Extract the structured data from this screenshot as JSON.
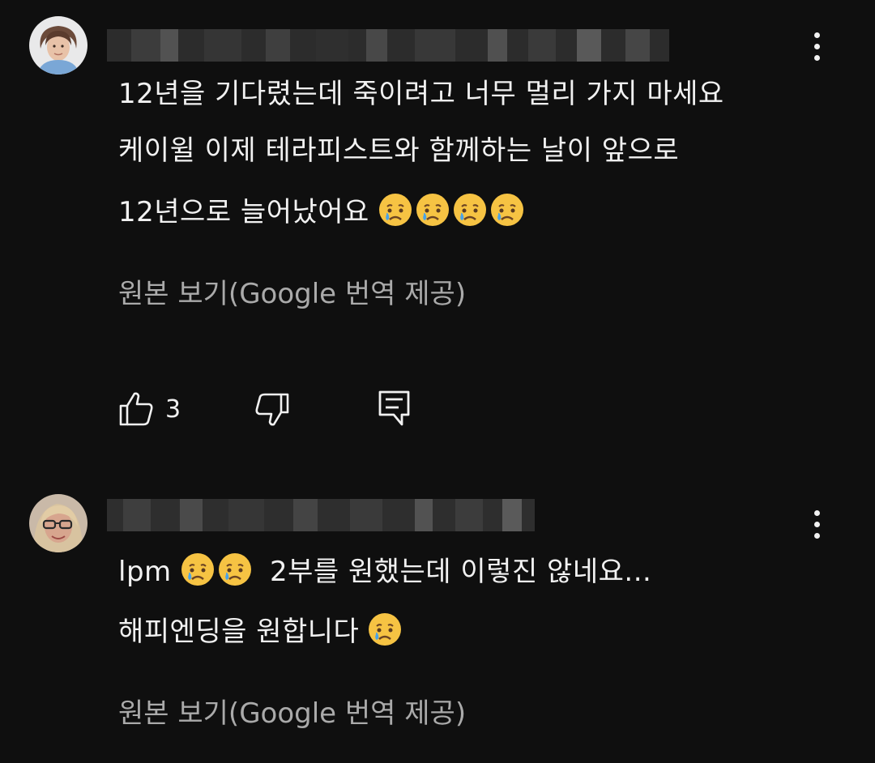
{
  "comments": [
    {
      "lines": [
        "12년을 기다렸는데 죽이려고 너무 멀리 가지 마세요",
        "케이윌 이제 테라피스트와 함께하는 날이 앞으로",
        "12년으로 늘어났어요"
      ],
      "emoji_count": 4,
      "translate_link": "원본 보기(Google 번역 제공)",
      "like_count": "3"
    },
    {
      "lines": [
        "lpm",
        "2부를 원했는데 이렇진 않네요...",
        "해피엔딩을 원합니다"
      ],
      "translate_link": "원본 보기(Google 번역 제공)"
    }
  ],
  "colors": {
    "background": "#0f0f0f",
    "text_primary": "#f1f1f1",
    "text_secondary": "#aaaaaa"
  },
  "icons": [
    "more-vertical-icon",
    "thumbs-up-icon",
    "thumbs-down-icon",
    "reply-icon",
    "crying-face-emoji"
  ]
}
